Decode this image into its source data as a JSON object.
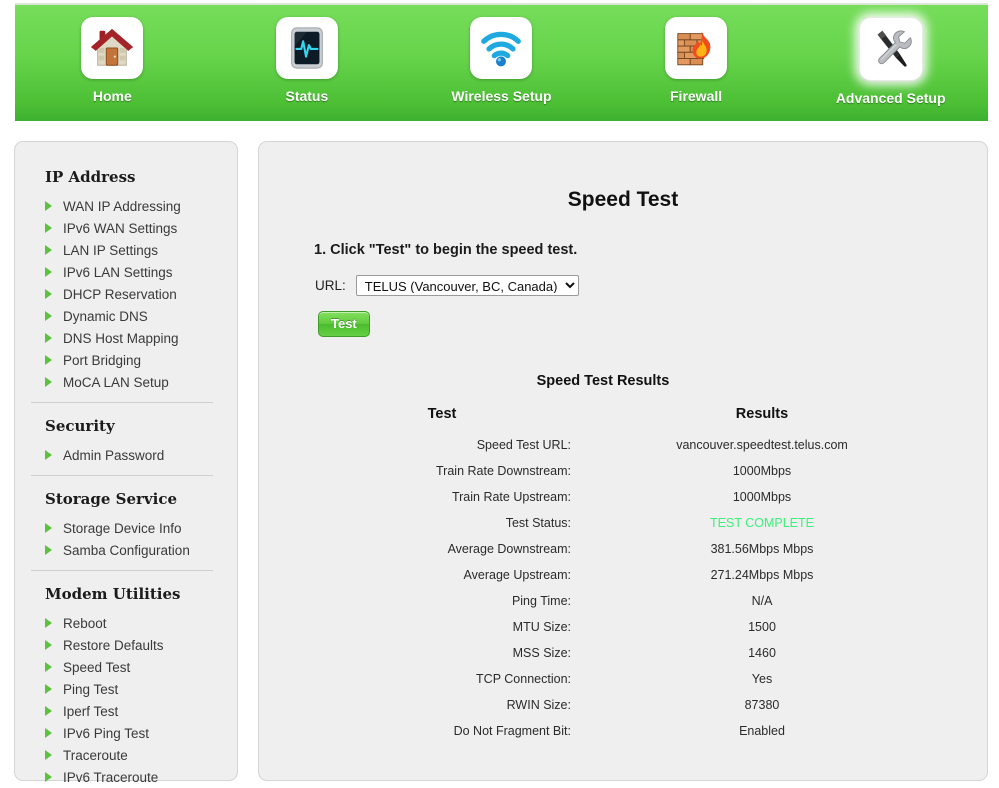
{
  "topnav": {
    "items": [
      {
        "label": "Home",
        "icon": "house-icon",
        "active": false
      },
      {
        "label": "Status",
        "icon": "monitor-pulse-icon",
        "active": false
      },
      {
        "label": "Wireless Setup",
        "icon": "wifi-icon",
        "active": false
      },
      {
        "label": "Firewall",
        "icon": "brick-wall-flame-icon",
        "active": false
      },
      {
        "label": "Advanced Setup",
        "icon": "screwdriver-wrench-icon",
        "active": true
      }
    ],
    "accent_color": "#5fcc43"
  },
  "sidebar": {
    "sections": [
      {
        "heading": "IP Address",
        "items": [
          "WAN IP Addressing",
          "IPv6 WAN Settings",
          "LAN IP Settings",
          "IPv6 LAN Settings",
          "DHCP Reservation",
          "Dynamic DNS",
          "DNS Host Mapping",
          "Port Bridging",
          "MoCA LAN Setup"
        ]
      },
      {
        "heading": "Security",
        "items": [
          "Admin Password"
        ]
      },
      {
        "heading": "Storage Service",
        "items": [
          "Storage Device Info",
          "Samba Configuration"
        ]
      },
      {
        "heading": "Modem Utilities",
        "items": [
          "Reboot",
          "Restore Defaults",
          "Speed Test",
          "Ping Test",
          "Iperf Test",
          "IPv6 Ping Test",
          "Traceroute",
          "IPv6 Traceroute"
        ]
      }
    ],
    "bullet_color": "#5cc23d"
  },
  "main": {
    "title": "Speed Test",
    "step_instruction": "1. Click \"Test\" to begin the speed test.",
    "url_label": "URL:",
    "url_selected": "TELUS (Vancouver, BC, Canada)",
    "url_options": [
      "TELUS (Vancouver, BC, Canada)"
    ],
    "test_button": "Test",
    "results_title": "Speed Test Results",
    "table": {
      "headers": [
        "Test",
        "Results"
      ],
      "rows": [
        {
          "test": "Speed Test URL:",
          "result": "vancouver.speedtest.telus.com",
          "status": false
        },
        {
          "test": "Train Rate Downstream:",
          "result": "1000Mbps",
          "status": false
        },
        {
          "test": "Train Rate Upstream:",
          "result": "1000Mbps",
          "status": false
        },
        {
          "test": "Test Status:",
          "result": "TEST COMPLETE",
          "status": true
        },
        {
          "test": "Average Downstream:",
          "result": "381.56Mbps Mbps",
          "status": false
        },
        {
          "test": "Average Upstream:",
          "result": "271.24Mbps Mbps",
          "status": false
        },
        {
          "test": "Ping Time:",
          "result": "N/A",
          "status": false
        },
        {
          "test": "MTU Size:",
          "result": "1500",
          "status": false
        },
        {
          "test": "MSS Size:",
          "result": "1460",
          "status": false
        },
        {
          "test": "TCP Connection:",
          "result": "Yes",
          "status": false
        },
        {
          "test": "RWIN Size:",
          "result": "87380",
          "status": false
        },
        {
          "test": "Do Not Fragment Bit:",
          "result": "Enabled",
          "status": false
        }
      ]
    },
    "status_color": "#3cf07a"
  }
}
